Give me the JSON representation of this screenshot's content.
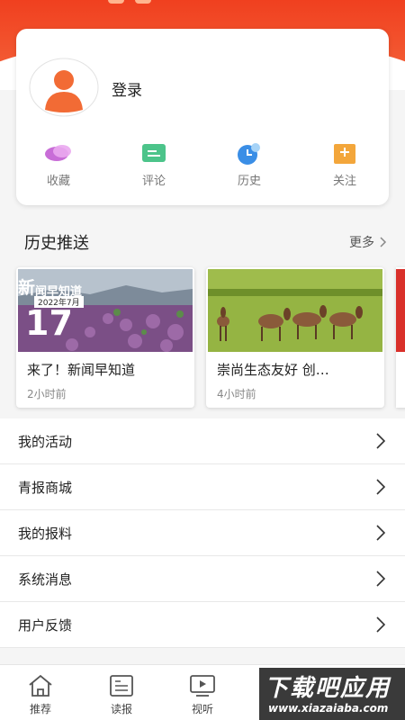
{
  "profile": {
    "login_label": "登录",
    "quick_actions": [
      {
        "label": "收藏",
        "icon": "favorite-icon",
        "color": "#c86dd7"
      },
      {
        "label": "评论",
        "icon": "comment-icon",
        "color": "#4cc48a"
      },
      {
        "label": "历史",
        "icon": "history-icon",
        "color": "#3a8ee6"
      },
      {
        "label": "关注",
        "icon": "follow-icon",
        "color": "#f3a63b"
      }
    ]
  },
  "history_push": {
    "title": "历史推送",
    "more_label": "更多",
    "cards": [
      {
        "title": "来了！新闻早知道",
        "time": "2小时前",
        "thumb_big": "新",
        "thumb_text": "闻早知道",
        "thumb_date": "2022年7月",
        "thumb_day": "17"
      },
      {
        "title": "崇尚生态友好 创…",
        "time": "4小时前"
      }
    ]
  },
  "menu": [
    {
      "label": "我的活动"
    },
    {
      "label": "青报商城"
    },
    {
      "label": "我的报料"
    },
    {
      "label": "系统消息"
    },
    {
      "label": "用户反馈"
    }
  ],
  "tabbar": [
    {
      "label": "推荐",
      "icon": "home-icon"
    },
    {
      "label": "读报",
      "icon": "newspaper-icon"
    },
    {
      "label": "视听",
      "icon": "video-icon"
    }
  ],
  "watermark": {
    "main": "下载吧应用",
    "sub": "www.xiazaiaba.com"
  },
  "colors": {
    "brand": "#f0401f",
    "avatar": "#f26b35"
  }
}
